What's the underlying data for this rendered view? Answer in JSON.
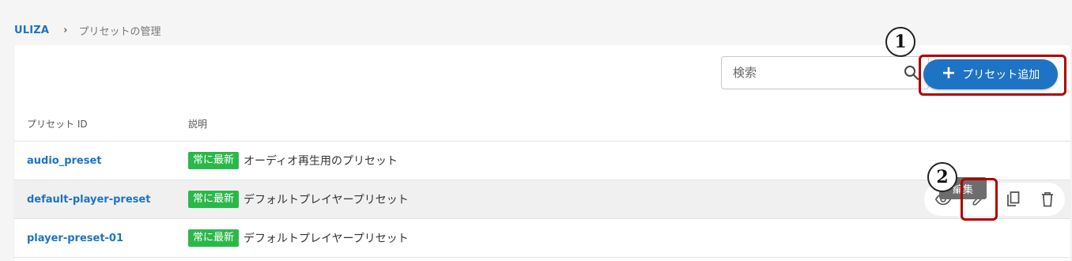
{
  "breadcrumb": {
    "root": "ULIZA",
    "separator": "›",
    "current": "プリセットの管理"
  },
  "toolbar": {
    "search_placeholder": "検索",
    "search_icon": "search-icon",
    "add_button_label": "プリセット追加",
    "add_button_icon": "+"
  },
  "table": {
    "columns": [
      "プリセット ID",
      "説明"
    ],
    "rows": [
      {
        "id": "audio_preset",
        "badge": "常に最新",
        "description": "オーディオ再生用のプリセット"
      },
      {
        "id": "default-player-preset",
        "badge": "常に最新",
        "description": "デフォルトプレイヤープリセット"
      },
      {
        "id": "player-preset-01",
        "badge": "常に最新",
        "description": "デフォルトプレイヤープリセット"
      }
    ]
  },
  "row_actions": {
    "icons": [
      "eye-icon",
      "pencil-icon",
      "copy-icon",
      "trash-icon"
    ],
    "tooltip": "編集"
  },
  "annotations": {
    "marker_1": "1",
    "marker_2": "2"
  },
  "colors": {
    "accent": "#1e73c4",
    "badge": "#2bb84a",
    "annotation": "#b00000"
  }
}
